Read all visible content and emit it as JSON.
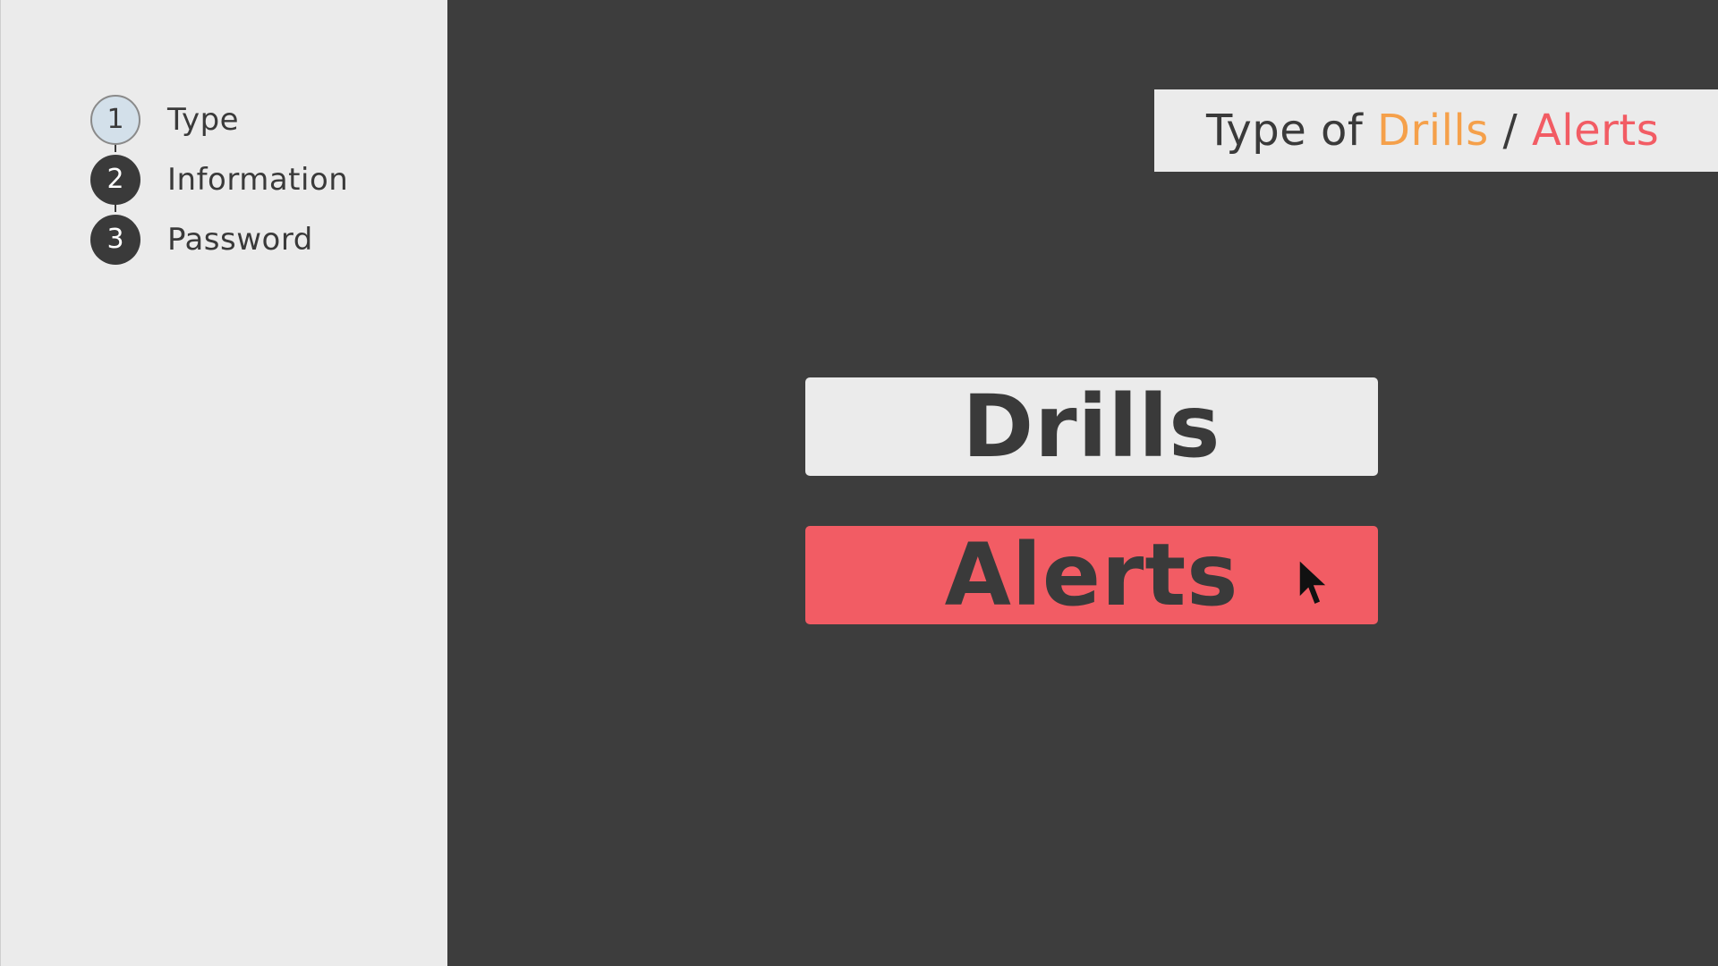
{
  "stepper": {
    "steps": [
      {
        "number": "1",
        "label": "Type",
        "state": "active"
      },
      {
        "number": "2",
        "label": "Information",
        "state": "inactive"
      },
      {
        "number": "3",
        "label": "Password",
        "state": "inactive"
      }
    ]
  },
  "header": {
    "prefix": "Type of ",
    "drills": "Drills",
    "separator": " / ",
    "alerts": "Alerts"
  },
  "choices": {
    "drills_label": "Drills",
    "alerts_label": "Alerts"
  },
  "colors": {
    "background": "#3d3d3d",
    "panel": "#ebebeb",
    "drills_accent": "#f5a04a",
    "alerts_accent": "#f25c64",
    "text_dark": "#3a3a3a",
    "active_step": "#d3e0ea"
  },
  "icons": {
    "cursor": "mouse-pointer-icon"
  }
}
